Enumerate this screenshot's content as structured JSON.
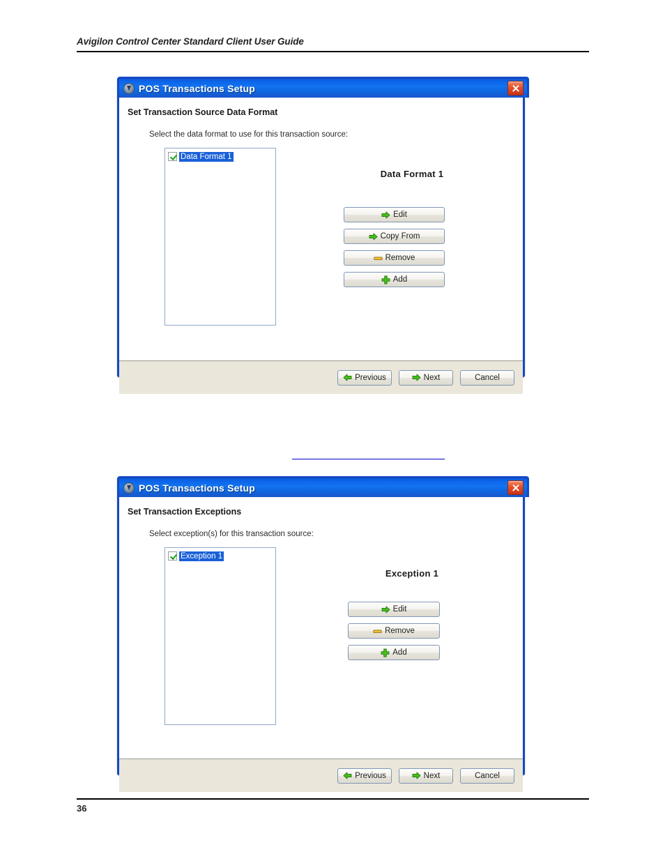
{
  "page": {
    "header_title": "Avigilon Control Center Standard Client User Guide",
    "page_number": "36"
  },
  "dialogs": [
    {
      "title": "POS Transactions Setup",
      "title_icon": "info-circle-icon",
      "close_icon": "close-icon",
      "section_heading": "Set Transaction Source Data Format",
      "instruction": "Select the data format to use for this transaction source:",
      "list": {
        "items": [
          {
            "label": "Data Format 1",
            "checked": true,
            "selected": true
          }
        ]
      },
      "panel_title": "Data Format 1",
      "actions": [
        {
          "label": "Edit",
          "icon": "arrow-right-green-icon"
        },
        {
          "label": "Copy From",
          "icon": "arrow-right-green-icon"
        },
        {
          "label": "Remove",
          "icon": "minus-yellow-icon"
        },
        {
          "label": "Add",
          "icon": "plus-green-icon"
        }
      ],
      "footer": [
        {
          "label": "Previous",
          "icon": "arrow-left-green-icon"
        },
        {
          "label": "Next",
          "icon": "arrow-right-green-icon"
        },
        {
          "label": "Cancel",
          "icon": "none"
        }
      ]
    },
    {
      "title": "POS Transactions Setup",
      "title_icon": "info-circle-icon",
      "close_icon": "close-icon",
      "section_heading": "Set Transaction Exceptions",
      "instruction": "Select exception(s) for this transaction source:",
      "list": {
        "items": [
          {
            "label": "Exception 1",
            "checked": true,
            "selected": true
          }
        ]
      },
      "panel_title": "Exception 1",
      "actions": [
        {
          "label": "Edit",
          "icon": "arrow-right-green-icon"
        },
        {
          "label": "Remove",
          "icon": "minus-yellow-icon"
        },
        {
          "label": "Add",
          "icon": "plus-green-icon"
        }
      ],
      "footer": [
        {
          "label": "Previous",
          "icon": "arrow-left-green-icon"
        },
        {
          "label": "Next",
          "icon": "arrow-right-green-icon"
        },
        {
          "label": "Cancel",
          "icon": "none"
        }
      ]
    }
  ],
  "colors": {
    "titlebar_blue": "#0f66e0",
    "dialog_border": "#1449c4",
    "close_red": "#e3512a",
    "selection_blue": "#1960d8",
    "check_green": "#12a113",
    "icon_green": "#3cb521",
    "icon_yellow": "#e8b13a",
    "footer_beige": "#eae6d9",
    "link_rule_blue": "#0000cc"
  }
}
